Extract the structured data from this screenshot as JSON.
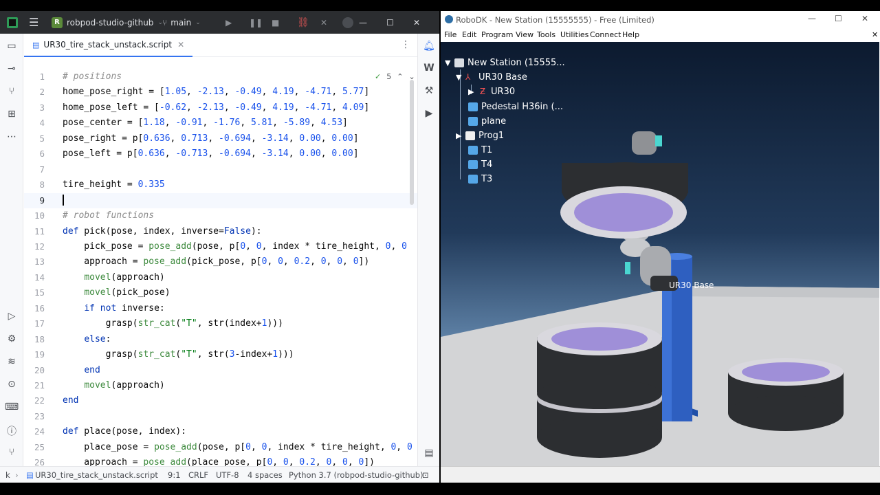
{
  "ide": {
    "project": "robpod-studio-github",
    "project_initial": "R",
    "branch": "main",
    "tab_label": "UR30_tire_stack_unstack.script",
    "inspection_count": "5",
    "lines": [
      {
        "n": "1",
        "html": "<span class=\"c-cmt\"># positions</span>"
      },
      {
        "n": "2",
        "html": "home_pose_right = [<span class=\"c-num\">1.05</span>, <span class=\"c-num\">-2.13</span>, <span class=\"c-num\">-0.49</span>, <span class=\"c-num\">4.19</span>, <span class=\"c-num\">-4.71</span>, <span class=\"c-num\">5.77</span>]"
      },
      {
        "n": "3",
        "html": "home_pose_left = [<span class=\"c-num\">-0.62</span>, <span class=\"c-num\">-2.13</span>, <span class=\"c-num\">-0.49</span>, <span class=\"c-num\">4.19</span>, <span class=\"c-num\">-4.71</span>, <span class=\"c-num\">4.09</span>]"
      },
      {
        "n": "4",
        "html": "pose_center = [<span class=\"c-num\">1.18</span>, <span class=\"c-num\">-0.91</span>, <span class=\"c-num\">-1.76</span>, <span class=\"c-num\">5.81</span>, <span class=\"c-num\">-5.89</span>, <span class=\"c-num\">4.53</span>]"
      },
      {
        "n": "5",
        "html": "pose_right = p[<span class=\"c-num\">0.636</span>, <span class=\"c-num\">0.713</span>, <span class=\"c-num\">-0.694</span>, <span class=\"c-num\">-3.14</span>, <span class=\"c-num\">0.00</span>, <span class=\"c-num\">0.00</span>]"
      },
      {
        "n": "6",
        "html": "pose_left = p[<span class=\"c-num\">0.636</span>, <span class=\"c-num\">-0.713</span>, <span class=\"c-num\">-0.694</span>, <span class=\"c-num\">-3.14</span>, <span class=\"c-num\">0.00</span>, <span class=\"c-num\">0.00</span>]"
      },
      {
        "n": "7",
        "html": ""
      },
      {
        "n": "8",
        "html": "tire_height = <span class=\"c-num\">0.335</span>"
      },
      {
        "n": "9",
        "html": "<span class=\"caret\"></span>",
        "current": true
      },
      {
        "n": "10",
        "html": "<span class=\"c-cmt\"># robot functions</span>"
      },
      {
        "n": "11",
        "html": "<span class=\"c-kw\">def</span> pick(pose, index, inverse=<span class=\"c-kw\">False</span>):"
      },
      {
        "n": "12",
        "html": "    pick_pose = <span class=\"c-call\">pose_add</span>(pose, p[<span class=\"c-num\">0</span>, <span class=\"c-num\">0</span>, index * tire_height, <span class=\"c-num\">0</span>, <span class=\"c-num\">0</span>"
      },
      {
        "n": "13",
        "html": "    approach = <span class=\"c-call\">pose_add</span>(pick_pose, p[<span class=\"c-num\">0</span>, <span class=\"c-num\">0</span>, <span class=\"c-num\">0.2</span>, <span class=\"c-num\">0</span>, <span class=\"c-num\">0</span>, <span class=\"c-num\">0</span>])"
      },
      {
        "n": "14",
        "html": "    <span class=\"c-call\">movel</span>(approach)"
      },
      {
        "n": "15",
        "html": "    <span class=\"c-call\">movel</span>(pick_pose)"
      },
      {
        "n": "16",
        "html": "    <span class=\"c-kw\">if not</span> inverse:"
      },
      {
        "n": "17",
        "html": "        grasp(<span class=\"c-call\">str_cat</span>(<span class=\"c-str\">\"T\"</span>, str(index+<span class=\"c-num\">1</span>)))"
      },
      {
        "n": "18",
        "html": "    <span class=\"c-kw\">else</span>:"
      },
      {
        "n": "19",
        "html": "        grasp(<span class=\"c-call\">str_cat</span>(<span class=\"c-str\">\"T\"</span>, str(<span class=\"c-num\">3</span>-index+<span class=\"c-num\">1</span>)))"
      },
      {
        "n": "20",
        "html": "    <span class=\"c-kw\">end</span>"
      },
      {
        "n": "21",
        "html": "    <span class=\"c-call\">movel</span>(approach)"
      },
      {
        "n": "22",
        "html": "<span class=\"c-kw\">end</span>"
      },
      {
        "n": "23",
        "html": ""
      },
      {
        "n": "24",
        "html": "<span class=\"c-kw\">def</span> place(pose, index):"
      },
      {
        "n": "25",
        "html": "    place_pose = <span class=\"c-call\">pose_add</span>(pose, p[<span class=\"c-num\">0</span>, <span class=\"c-num\">0</span>, index * tire_height, <span class=\"c-num\">0</span>, <span class=\"c-num\">0</span>"
      },
      {
        "n": "26",
        "html": "    approach = <span class=\"c-call\">pose_add</span>(place_pose, p[<span class=\"c-num\">0</span>, <span class=\"c-num\">0</span>, <span class=\"c-num\">0.2</span>, <span class=\"c-num\">0</span>, <span class=\"c-num\">0</span>, <span class=\"c-num\">0</span>])"
      }
    ],
    "status": {
      "breadcrumb_prefix": "k",
      "file": "UR30_tire_stack_unstack.script",
      "position": "9:1",
      "line_endings": "CRLF",
      "encoding": "UTF-8",
      "indent": "4 spaces",
      "interpreter": "Python 3.7 (robpod-studio-github)"
    }
  },
  "robodk": {
    "title": "RoboDK - New Station (15555555) - Free (Limited)",
    "menu": [
      "File",
      "Edit",
      "Program",
      "View",
      "Tools",
      "Utilities",
      "Connect",
      "Help"
    ],
    "tree": [
      {
        "label": "New Station (15555...",
        "icon": "station-icon"
      },
      {
        "label": "UR30 Base",
        "icon": "frame-icon"
      },
      {
        "label": "UR30",
        "icon": "robot-icon"
      },
      {
        "label": "Pedestal H36in (...",
        "icon": "object-icon"
      },
      {
        "label": "plane",
        "icon": "object-icon"
      },
      {
        "label": "Prog1",
        "icon": "program-icon"
      },
      {
        "label": "T1",
        "icon": "object-icon"
      },
      {
        "label": "T4",
        "icon": "object-icon"
      },
      {
        "label": "T3",
        "icon": "object-icon"
      }
    ],
    "scene_label": "UR30 Base"
  }
}
